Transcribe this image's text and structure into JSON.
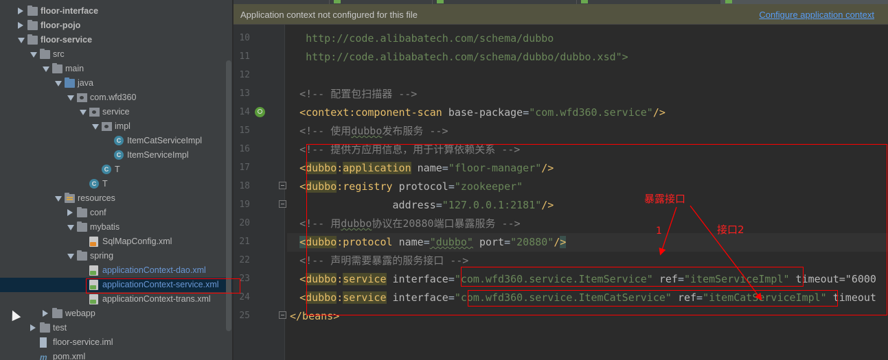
{
  "banner": {
    "message": "Application context not configured for this file",
    "link": "Configure application context"
  },
  "tree": [
    {
      "label": "floor-interface",
      "arrow": "right",
      "icon": "folder",
      "bold": true
    },
    {
      "label": "floor-pojo",
      "arrow": "right",
      "icon": "folder",
      "bold": true
    },
    {
      "label": "floor-service",
      "arrow": "down",
      "icon": "folder",
      "bold": true
    },
    {
      "label": "src",
      "arrow": "down",
      "icon": "folder"
    },
    {
      "label": "main",
      "arrow": "down",
      "icon": "folder"
    },
    {
      "label": "java",
      "arrow": "down",
      "icon": "folder-blue"
    },
    {
      "label": "com.wfd360",
      "arrow": "down",
      "icon": "package"
    },
    {
      "label": "service",
      "arrow": "down",
      "icon": "package"
    },
    {
      "label": "impl",
      "arrow": "down",
      "icon": "package"
    },
    {
      "label": "ItemCatServiceImpl",
      "icon": "class",
      "class_letter": "C"
    },
    {
      "label": "ItemServiceImpl",
      "icon": "class",
      "class_letter": "C"
    },
    {
      "label": "T",
      "icon": "class",
      "class_letter": "C"
    },
    {
      "label": "T",
      "icon": "class",
      "class_letter": "C"
    },
    {
      "label": "resources",
      "arrow": "down",
      "icon": "folder-res"
    },
    {
      "label": "conf",
      "arrow": "right",
      "icon": "folder"
    },
    {
      "label": "mybatis",
      "arrow": "down",
      "icon": "folder"
    },
    {
      "label": "SqlMapConfig.xml",
      "icon": "xml"
    },
    {
      "label": "spring",
      "arrow": "down",
      "icon": "folder"
    },
    {
      "label": "applicationContext-dao.xml",
      "icon": "xml-spring",
      "blue": true
    },
    {
      "label": "applicationContext-service.xml",
      "icon": "xml-spring",
      "blue": true,
      "selected": true
    },
    {
      "label": "applicationContext-trans.xml",
      "icon": "xml-spring"
    },
    {
      "label": "webapp",
      "arrow": "right",
      "icon": "folder"
    },
    {
      "label": "test",
      "arrow": "right",
      "icon": "folder"
    },
    {
      "label": "floor-service.iml",
      "icon": "iml"
    },
    {
      "label": "pom.xml",
      "icon": "maven",
      "icon_glyph": "m"
    }
  ],
  "code": {
    "line_numbers": [
      "10",
      "11",
      "12",
      "13",
      "14",
      "15",
      "16",
      "17",
      "18",
      "19",
      "20",
      "21",
      "22",
      "23",
      "24",
      "25"
    ],
    "url1": "http://code.alibabatech.com/schema/dubbo",
    "url2": "http://code.alibabatech.com/schema/dubbo/dubbo.xsd\">",
    "c_scan": "<!-- 配置包扫描器 -->",
    "scan_tag": "component-scan",
    "scan_ns": "context",
    "scan_attr": "base-package",
    "scan_val": "\"com.wfd360.service\"",
    "c_publish_pre": "<!-- 使用",
    "c_publish_word": "dubbo",
    "c_publish_post": "发布服务 -->",
    "c_app": "<!-- 提供方应用信息，用于计算依赖关系 -->",
    "ns": "dubbo",
    "app_tag": "application",
    "app_attr": "name",
    "app_val": "\"floor-manager\"",
    "reg_tag": "registry",
    "reg_attr1": "protocol",
    "reg_val1": "\"zookeeper\"",
    "reg_attr2": "address",
    "reg_val2": "\"127.0.0.1:2181\"",
    "c_proto_pre": "<!-- 用",
    "c_proto_word": "dubbo",
    "c_proto_post": "协议在20880端口暴露服务 -->",
    "proto_tag": "protocol",
    "proto_attr1": "name",
    "proto_val1": "\"dubbo\"",
    "proto_attr2": "port",
    "proto_val2": "\"20880\"",
    "c_service": "<!-- 声明需要暴露的服务接口 -->",
    "svc_tag": "service",
    "svc_attr1": "interface",
    "svc1_val1": "\"com.wfd360.service.ItemService\"",
    "svc_attr2": "ref",
    "svc1_val2": "\"itemServiceImpl\"",
    "svc1_timeout": "timeout=\"6000",
    "svc2_val1": "\"com.wfd360.service.ItemCatService\"",
    "svc2_val2": "\"itemCatServiceImpl\"",
    "svc2_timeout": "timeout",
    "close_beans": "</beans>"
  },
  "annotations": {
    "expose_label": "暴露接口",
    "label_1": "1",
    "label_2": "接口2"
  },
  "colors": {
    "annotation_red": "#ff0000",
    "tag": "#e8bf6a",
    "string": "#6a8759",
    "comment": "#808080",
    "link": "#589df6"
  }
}
